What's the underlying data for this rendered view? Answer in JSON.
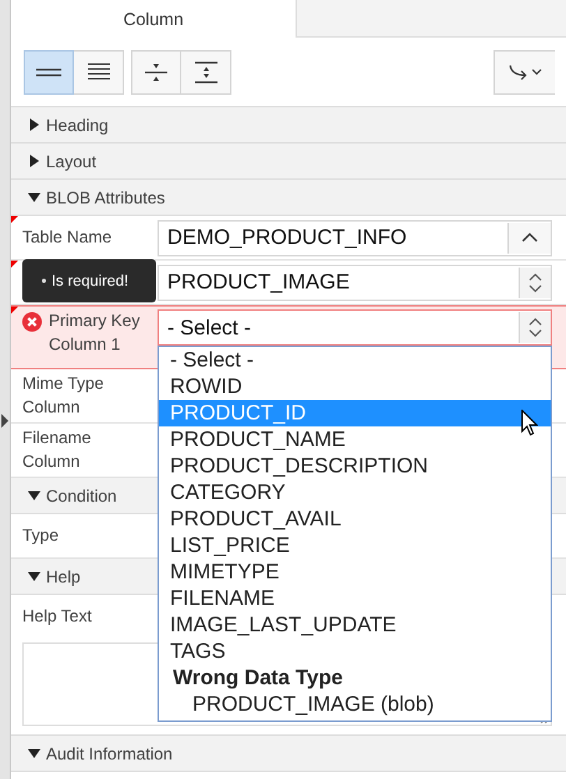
{
  "tabs": [
    {
      "label": "Column",
      "selected": true
    }
  ],
  "toolbar": [
    {
      "kind": "compact",
      "selected": true
    },
    {
      "kind": "lines",
      "selected": false
    },
    {
      "kind": "collapse",
      "selected": false
    },
    {
      "kind": "expand",
      "selected": false
    }
  ],
  "rows": [
    {
      "kind": "section",
      "label": "Heading",
      "expanded": false
    },
    {
      "kind": "section",
      "label": "Layout",
      "expanded": false
    },
    {
      "kind": "section",
      "label": "BLOB Attributes",
      "expanded": true
    },
    {
      "kind": "lov",
      "label": "Table Name",
      "value": "DEMO_PRODUCT_INFO",
      "required": true,
      "error": false
    },
    {
      "kind": "select",
      "value": "PRODUCT_IMAGE",
      "required": true,
      "error": false
    },
    {
      "kind": "select",
      "label": "Primary Key Column 1",
      "value": "- Select -",
      "required": true,
      "error": true
    },
    {
      "kind": "field",
      "label": "Mime Type Column",
      "required": false,
      "error": false
    },
    {
      "kind": "field",
      "label": "Filename Column",
      "required": false,
      "error": false
    },
    {
      "kind": "section",
      "label": "Condition",
      "expanded": true
    },
    {
      "kind": "field",
      "label": "Type",
      "required": false,
      "error": false
    },
    {
      "kind": "section",
      "label": "Help",
      "expanded": true
    },
    {
      "kind": "textarea",
      "label": "Help Text"
    },
    {
      "kind": "section",
      "label": "Audit Information",
      "expanded": true
    }
  ],
  "tooltip": {
    "text": "Is required!"
  },
  "dropdown": {
    "options": [
      {
        "label": "- Select -",
        "selected": false
      },
      {
        "label": "ROWID",
        "selected": false
      },
      {
        "label": "PRODUCT_ID",
        "selected": true
      },
      {
        "label": "PRODUCT_NAME",
        "selected": false
      },
      {
        "label": "PRODUCT_DESCRIPTION",
        "selected": false
      },
      {
        "label": "CATEGORY",
        "selected": false
      },
      {
        "label": "PRODUCT_AVAIL",
        "selected": false
      },
      {
        "label": "LIST_PRICE",
        "selected": false
      },
      {
        "label": "MIMETYPE",
        "selected": false
      },
      {
        "label": "FILENAME",
        "selected": false
      },
      {
        "label": "IMAGE_LAST_UPDATE",
        "selected": false
      },
      {
        "label": "TAGS",
        "selected": false
      }
    ],
    "groups": [
      {
        "label": "Wrong Data Type",
        "options": [
          {
            "label": "PRODUCT_IMAGE (blob)",
            "selected": false
          }
        ]
      }
    ]
  }
}
